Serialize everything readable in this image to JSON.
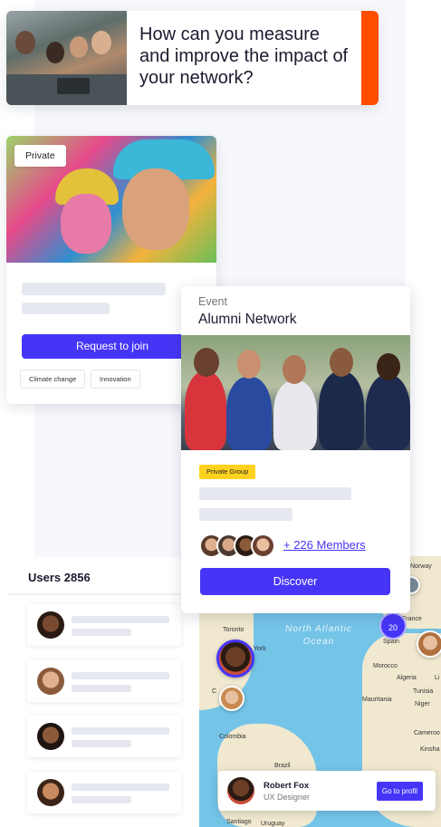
{
  "question_card": {
    "text": "How can you measure and improve the impact of your network?",
    "accent_color": "#ff4d00"
  },
  "group_card": {
    "badge": "Private",
    "button_label": "Request to join",
    "tags": [
      "Climate change",
      "Innovation"
    ]
  },
  "event_card": {
    "label": "Event",
    "title": "Alumni Network",
    "badge": "Private Group",
    "members_label": "+ 226 Members",
    "button_label": "Discover"
  },
  "users_panel": {
    "title": "Users 2856"
  },
  "map": {
    "ocean_label": "North Atlantic Ocean",
    "cluster_count": "20",
    "places": {
      "toronto": "Toronto",
      "york": "York",
      "norway": "Norway",
      "france": "France",
      "spain": "Spain",
      "morocco": "Morocco",
      "algeria": "Algeria",
      "tunisia": "Tunisia",
      "mauritania": "Mauritania",
      "niger": "Niger",
      "cameroon": "Cameroo",
      "kinshasa": "Kinsha",
      "colombia": "Colombia",
      "brazil": "Brazil",
      "santiago": "Santiago",
      "uruguay": "Uruguay",
      "li": "Li",
      "c": "C"
    }
  },
  "profile_card": {
    "name": "Robert Fox",
    "role": "UX Designer",
    "button_label": "Go to profil"
  },
  "colors": {
    "primary": "#4635f7",
    "badge_yellow": "#ffd21f"
  }
}
